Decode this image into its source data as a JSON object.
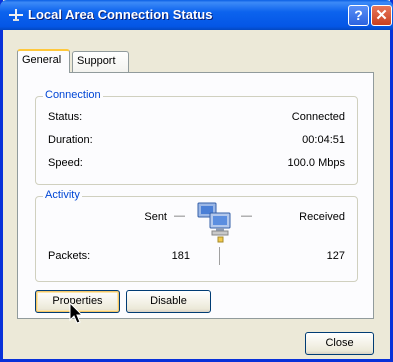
{
  "window": {
    "title": "Local Area Connection Status",
    "help_glyph": "?",
    "close_glyph": "✕"
  },
  "tabs": [
    {
      "label": "General",
      "active": true
    },
    {
      "label": "Support",
      "active": false
    }
  ],
  "connection": {
    "legend": "Connection",
    "status_label": "Status:",
    "status_value": "Connected",
    "duration_label": "Duration:",
    "duration_value": "00:04:51",
    "speed_label": "Speed:",
    "speed_value": "100.0 Mbps"
  },
  "activity": {
    "legend": "Activity",
    "sent_label": "Sent",
    "received_label": "Received",
    "packets_label": "Packets:",
    "packets_sent": "181",
    "packets_received": "127",
    "separator": "—"
  },
  "buttons": {
    "properties": "Properties",
    "disable": "Disable",
    "close": "Close"
  },
  "colors": {
    "titlebar": "#0c63ee",
    "legend_text": "#0046d5",
    "tab_highlight": "#ffc83c"
  }
}
